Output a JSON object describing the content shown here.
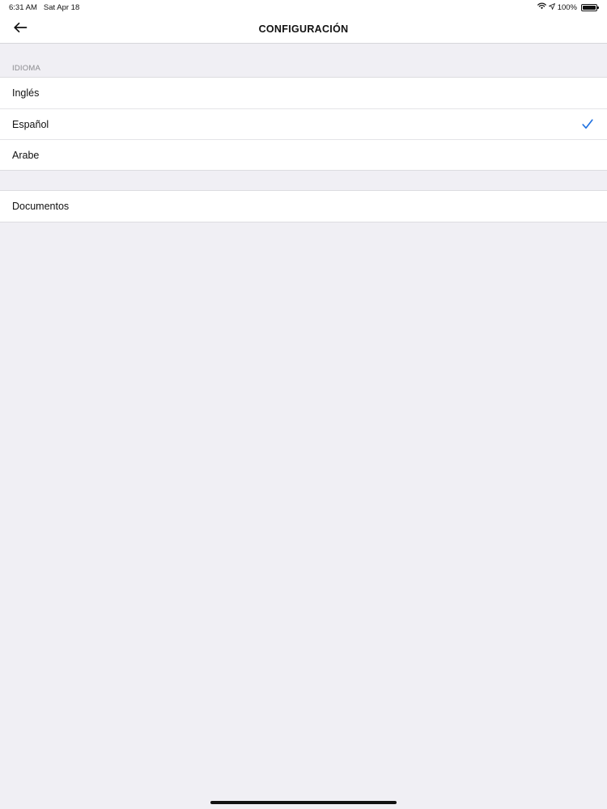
{
  "status_bar": {
    "time": "6:31 AM",
    "date": "Sat Apr 18",
    "battery_text": "100%",
    "icons": [
      "wifi-icon",
      "location-arrow-icon",
      "battery-icon"
    ]
  },
  "nav": {
    "title": "CONFIGURACIÓN",
    "back_icon": "back-arrow-icon"
  },
  "language_section": {
    "header": "IDIOMA",
    "items": [
      {
        "label": "Inglés",
        "selected": false
      },
      {
        "label": "Español",
        "selected": true
      },
      {
        "label": "Arabe",
        "selected": false
      }
    ],
    "check_icon": "checkmark-icon"
  },
  "documents_section": {
    "items": [
      {
        "label": "Documentos"
      }
    ]
  },
  "colors": {
    "accent": "#1c6fe0",
    "background": "#f0eff4",
    "surface": "#ffffff",
    "section_header_text": "#8a8a8e"
  }
}
